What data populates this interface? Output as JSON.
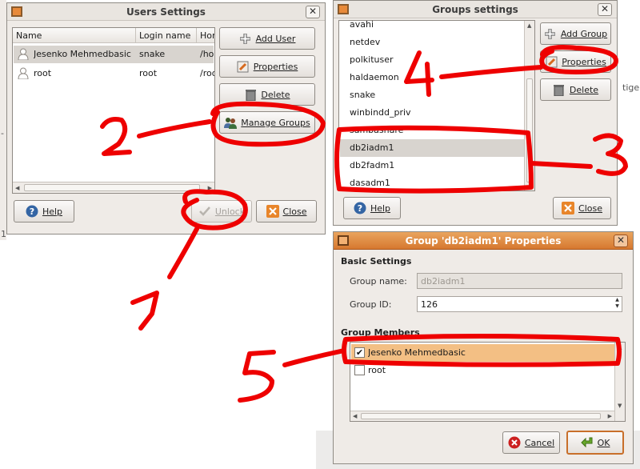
{
  "colors": {
    "annotation": "#ee0000",
    "titlebar_active": "#d6782f",
    "window_bg": "#efebe7",
    "selection": "#d8d4cf"
  },
  "background": {
    "fragment_right": "tige",
    "fragment_left_1": "-",
    "fragment_left_2": "1"
  },
  "users_window": {
    "title": "Users Settings",
    "columns": [
      "Name",
      "Login name",
      "Hor"
    ],
    "rows": [
      {
        "name": "Jesenko Mehmedbasic",
        "login": "snake",
        "home": "/hor",
        "selected": true
      },
      {
        "name": "root",
        "login": "root",
        "home": "/roo",
        "selected": false
      }
    ],
    "buttons": {
      "add_user": "Add User",
      "properties": "Properties",
      "delete": "Delete",
      "manage_groups": "Manage Groups"
    },
    "footer": {
      "help": "Help",
      "unlock": "Unlock",
      "close": "Close"
    }
  },
  "groups_window": {
    "title": "Groups settings",
    "groups": [
      "avahi",
      "netdev",
      "polkituser",
      "haldaemon",
      "snake",
      "winbindd_priv",
      "sambashare",
      "db2iadm1",
      "db2fadm1",
      "dasadm1"
    ],
    "selected_group": "db2iadm1",
    "buttons": {
      "add_group": "Add Group",
      "properties": "Properties",
      "delete": "Delete"
    },
    "footer": {
      "help": "Help",
      "close": "Close"
    }
  },
  "group_props_window": {
    "title": "Group 'db2iadm1' Properties",
    "basic_settings": "Basic Settings",
    "group_name_label": "Group name:",
    "group_name_value": "db2iadm1",
    "group_id_label": "Group ID:",
    "group_id_value": "126",
    "members_label": "Group Members",
    "members": [
      {
        "name": "Jesenko Mehmedbasic",
        "checked": true
      },
      {
        "name": "root",
        "checked": false
      }
    ],
    "footer": {
      "cancel": "Cancel",
      "ok": "OK"
    }
  },
  "annotations": [
    "1",
    "2",
    "3",
    "4",
    "5"
  ]
}
